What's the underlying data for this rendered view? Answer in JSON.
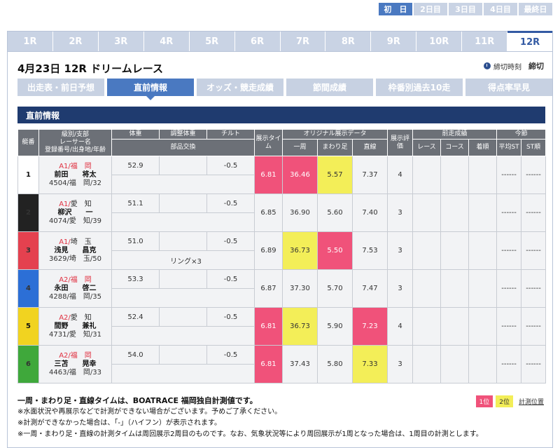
{
  "day_tabs": [
    "初　日",
    "2日目",
    "3日目",
    "4日目",
    "最終日"
  ],
  "race_tabs": [
    "1R",
    "2R",
    "3R",
    "4R",
    "5R",
    "6R",
    "7R",
    "8R",
    "9R",
    "10R",
    "11R",
    "12R"
  ],
  "race_title": "4月23日  12R  ドリームレース",
  "deadline": {
    "label": "締切時刻",
    "value": "締切"
  },
  "sub_tabs": [
    "出走表・前日予想",
    "直前情報",
    "オッズ・競走成績",
    "節間成績",
    "枠番別過去10走",
    "得点率早見"
  ],
  "section_title": "直前情報",
  "headers": {
    "waku": "艇番",
    "racer": [
      "級別/支部",
      "レーサー名",
      "登録番号/出身地/年齢"
    ],
    "weight": "体重",
    "adj_weight": "調整体重",
    "tilt": "チルト",
    "parts": "部品交換",
    "exh_time": "展示タイム",
    "original": "オリジナル展示データ",
    "lap": "一周",
    "mawari": "まわり足",
    "straight": "直線",
    "exh_eval": "展示評価",
    "prev": "前走成績",
    "prev_race": "レース",
    "prev_course": "コース",
    "prev_result": "着順",
    "konsetsu": "今節",
    "avg_st": "平均ST",
    "st_order": "ST順"
  },
  "rows": [
    {
      "waku": "1",
      "cls": "A1/",
      "branch": "福　岡",
      "branch_red": true,
      "name": "前田　　将太",
      "id": "4504/福　岡/32",
      "weight": "52.9",
      "adj": "",
      "tilt": "-0.5",
      "parts": "",
      "exh": "6.81",
      "exh_hl": "pink",
      "lap": "36.46",
      "lap_hl": "pink",
      "mawari": "5.57",
      "mawari_hl": "yellow",
      "straight": "7.37",
      "straight_hl": "",
      "eval": "4",
      "prev_race": "",
      "prev_course": "",
      "prev_result": "",
      "avg_st": "------",
      "st_order": "------"
    },
    {
      "waku": "2",
      "cls": "A1/",
      "branch": "愛　知",
      "branch_red": false,
      "name": "柳沢　　一",
      "id": "4074/愛　知/39",
      "weight": "51.1",
      "adj": "",
      "tilt": "-0.5",
      "parts": "",
      "exh": "6.85",
      "exh_hl": "",
      "lap": "36.90",
      "lap_hl": "",
      "mawari": "5.60",
      "mawari_hl": "",
      "straight": "7.40",
      "straight_hl": "",
      "eval": "3",
      "prev_race": "",
      "prev_course": "",
      "prev_result": "",
      "avg_st": "------",
      "st_order": "------"
    },
    {
      "waku": "3",
      "cls": "A1/",
      "branch": "埼　玉",
      "branch_red": false,
      "name": "浅見　　昌克",
      "id": "3629/埼　玉/50",
      "weight": "51.0",
      "adj": "",
      "tilt": "-0.5",
      "parts": "リング×3",
      "exh": "6.89",
      "exh_hl": "",
      "lap": "36.73",
      "lap_hl": "yellow",
      "mawari": "5.50",
      "mawari_hl": "pink",
      "straight": "7.53",
      "straight_hl": "",
      "eval": "3",
      "prev_race": "",
      "prev_course": "",
      "prev_result": "",
      "avg_st": "------",
      "st_order": "------"
    },
    {
      "waku": "4",
      "cls": "A2/",
      "branch": "福　岡",
      "branch_red": true,
      "name": "永田　　啓二",
      "id": "4288/福　岡/35",
      "weight": "53.3",
      "adj": "",
      "tilt": "-0.5",
      "parts": "",
      "exh": "6.87",
      "exh_hl": "",
      "lap": "37.30",
      "lap_hl": "",
      "mawari": "5.70",
      "mawari_hl": "",
      "straight": "7.47",
      "straight_hl": "",
      "eval": "3",
      "prev_race": "",
      "prev_course": "",
      "prev_result": "",
      "avg_st": "------",
      "st_order": "------"
    },
    {
      "waku": "5",
      "cls": "A2/",
      "branch": "愛　知",
      "branch_red": false,
      "name": "間野　　兼礼",
      "id": "4731/愛　知/31",
      "weight": "52.4",
      "adj": "",
      "tilt": "-0.5",
      "parts": "",
      "exh": "6.81",
      "exh_hl": "pink",
      "lap": "36.73",
      "lap_hl": "yellow",
      "mawari": "5.90",
      "mawari_hl": "",
      "straight": "7.23",
      "straight_hl": "pink",
      "eval": "4",
      "prev_race": "",
      "prev_course": "",
      "prev_result": "",
      "avg_st": "------",
      "st_order": "------"
    },
    {
      "waku": "6",
      "cls": "A2/",
      "branch": "福　岡",
      "branch_red": true,
      "name": "三苫　　晃幸",
      "id": "4463/福　岡/33",
      "weight": "54.0",
      "adj": "",
      "tilt": "-0.5",
      "parts": "",
      "exh": "6.81",
      "exh_hl": "pink",
      "lap": "37.43",
      "lap_hl": "",
      "mawari": "5.80",
      "mawari_hl": "",
      "straight": "7.33",
      "straight_hl": "yellow",
      "eval": "3",
      "prev_race": "",
      "prev_course": "",
      "prev_result": "",
      "avg_st": "------",
      "st_order": "------"
    }
  ],
  "notes": [
    "一周・まわり足・直線タイムは、BOATRACE 福岡独自計測値です。",
    "※水面状況や再展示などで計測ができない場合がございます。予めご了承ください。",
    "※計測ができなかった場合は、「-」（ハイフン）が表示されます。",
    "※一周・まわり足・直線の計測タイムは周回展示2周目のものです。なお、気象状況等により周回展示が1周となった場合は、1周目の計測とします。"
  ],
  "legend": {
    "first": "1位",
    "second": "2位",
    "link": "計測位置"
  },
  "colors": {
    "accent": "#4a79c1",
    "header_bar": "#1f3b6f",
    "first": "#f0527a",
    "second": "#f3ee58"
  }
}
